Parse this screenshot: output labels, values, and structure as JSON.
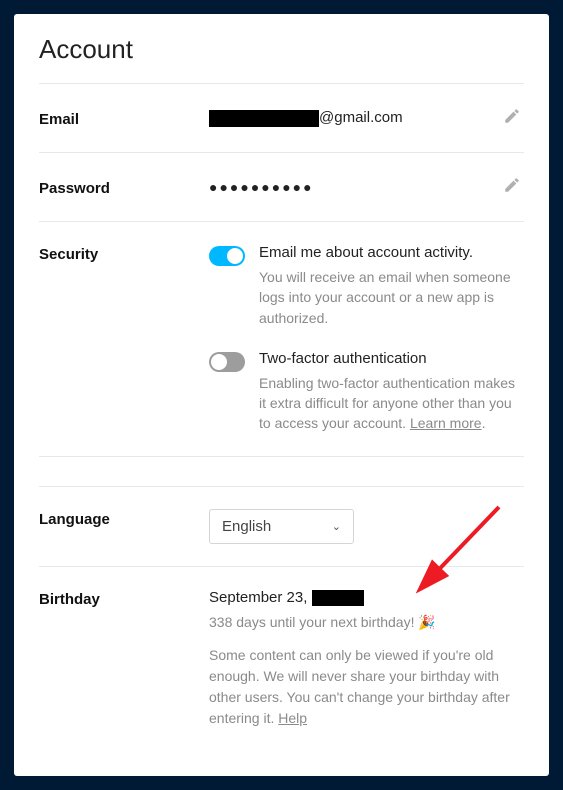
{
  "title": "Account",
  "email": {
    "label": "Email",
    "domain": "@gmail.com"
  },
  "password": {
    "label": "Password",
    "masked": "●●●●●●●●●●"
  },
  "security": {
    "label": "Security",
    "activity": {
      "title": "Email me about account activity.",
      "desc": "You will receive an email when someone logs into your account or a new app is authorized."
    },
    "twofa": {
      "title": "Two-factor authentication",
      "desc_prefix": "Enabling two-factor authentication makes it extra difficult for anyone other than you to access your account. ",
      "learn_more": "Learn more"
    }
  },
  "language": {
    "label": "Language",
    "selected": "English"
  },
  "birthday": {
    "label": "Birthday",
    "date_prefix": "September 23, ",
    "countdown": "338 days until your next birthday! 🎉",
    "note_prefix": "Some content can only be viewed if you're old enough. We will never share your birthday with other users. You can't change your birthday after entering it. ",
    "help": "Help"
  }
}
